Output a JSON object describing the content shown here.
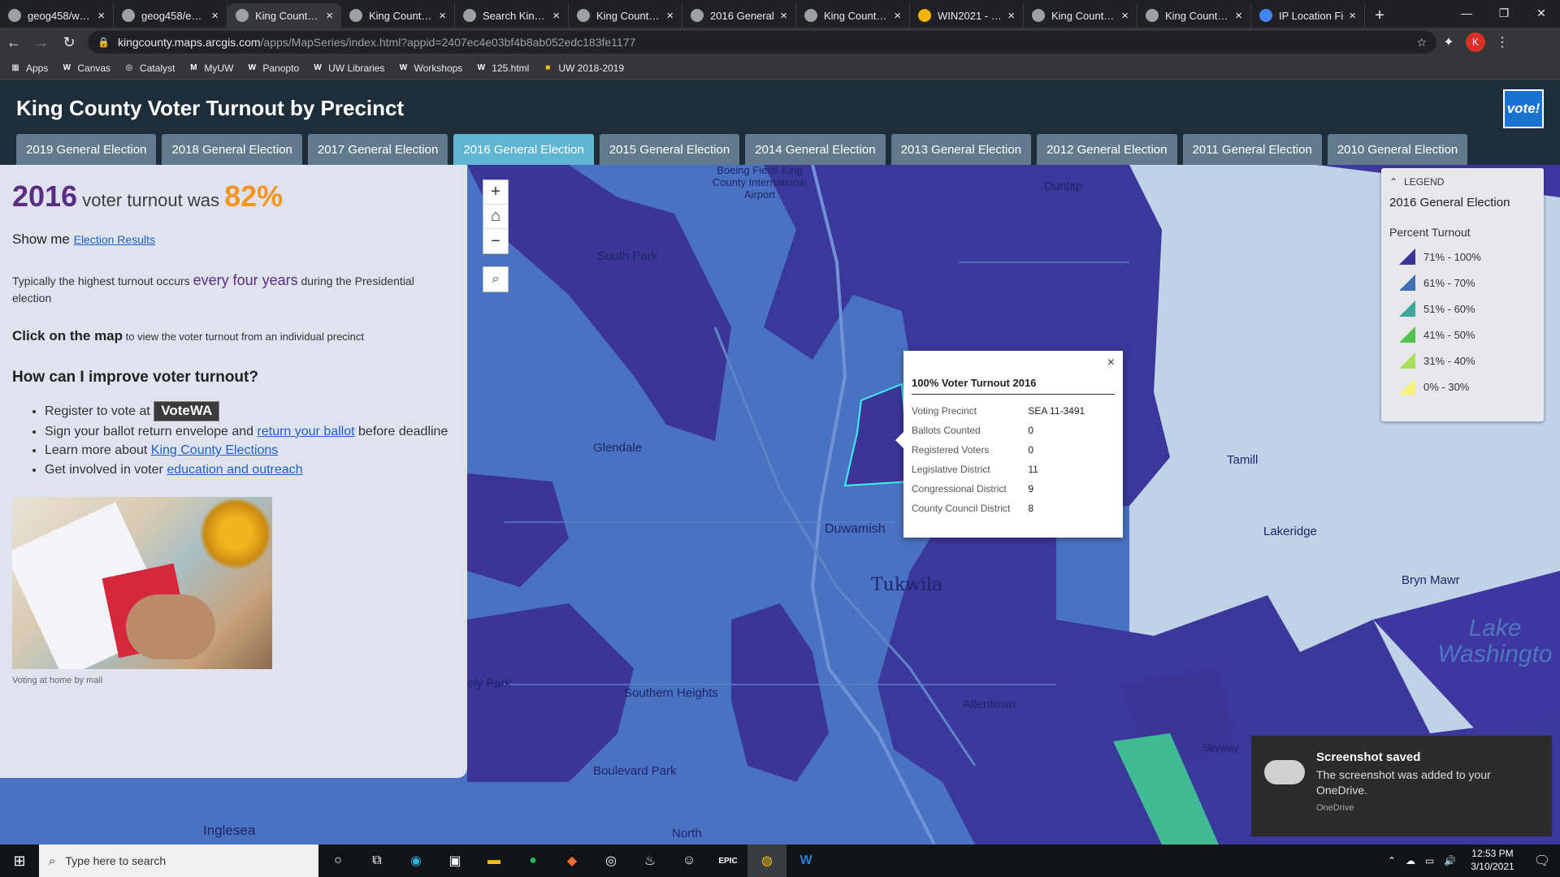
{
  "browser": {
    "tabs": [
      {
        "title": "geog458/week"
      },
      {
        "title": "geog458/essa"
      },
      {
        "title": "King County V"
      },
      {
        "title": "King County V"
      },
      {
        "title": "Search King C"
      },
      {
        "title": "King County G"
      },
      {
        "title": "2016 General"
      },
      {
        "title": "King County G"
      },
      {
        "title": "WIN2021 - Go"
      },
      {
        "title": "King County V"
      },
      {
        "title": "King County V"
      },
      {
        "title": "IP Location Fi"
      }
    ],
    "url_domain": "kingcounty.maps.arcgis.com",
    "url_path": "/apps/MapSeries/index.html?appid=2407ec4e03bf4b8ab052edc183fe1177",
    "profile_initial": "K",
    "bookmarks": [
      "Apps",
      "Canvas",
      "Catalyst",
      "MyUW",
      "Panopto",
      "UW Libraries",
      "Workshops",
      "125.html",
      "UW 2018-2019"
    ]
  },
  "app": {
    "title": "King County Voter Turnout by Precinct",
    "logo_text": "vote!",
    "election_tabs": [
      "2019 General Election",
      "2018 General Election",
      "2017 General Election",
      "2016 General Election",
      "2015 General Election",
      "2014 General Election",
      "2013 General Election",
      "2012 General Election",
      "2011 General Election",
      "2010 General Election"
    ],
    "active_tab_index": 3
  },
  "panel": {
    "year": "2016",
    "turnout_text": "voter turnout was",
    "turnout_pct": "82%",
    "show_me": "Show me",
    "election_results_link": "Election Results",
    "typically_pre": "Typically the highest turnout occurs",
    "typically_em": "every four years",
    "typically_post": "during the Presidential election",
    "click_bold": "Click on the map",
    "click_rest": "to view the voter turnout from an individual precinct",
    "how_heading": "How can I improve voter turnout?",
    "items": {
      "register": "Register to vote at",
      "votewa": "VoteWA",
      "sign_pre": "Sign your ballot return envelope and",
      "sign_link": "return your ballot",
      "sign_post": "before deadline",
      "learn_pre": "Learn more about",
      "learn_link": "King County Elections",
      "involve_pre": "Get involved in voter",
      "involve_link": "education and outreach"
    },
    "caption": "Voting at home by mail"
  },
  "map": {
    "zoom_in": "+",
    "home": "⌂",
    "zoom_out": "−",
    "search": "⌕",
    "popup": {
      "close": "×",
      "title": "100% Voter Turnout 2016",
      "rows": [
        {
          "label": "Voting Precinct",
          "value": "SEA 11-3491"
        },
        {
          "label": "Ballots Counted",
          "value": "0"
        },
        {
          "label": "Registered Voters",
          "value": "0"
        },
        {
          "label": "Legislative District",
          "value": "11"
        },
        {
          "label": "Congressional District",
          "value": "9"
        },
        {
          "label": "County Council District",
          "value": "8"
        }
      ]
    },
    "labels": {
      "tukwila": "Tukwila",
      "lake": "Lake Washingto",
      "boeing": "Boeing Field/ King County International Airport",
      "glendale": "Glendale",
      "south_park": "South Park",
      "duwamish": "Duwamish",
      "allentown": "Allentown",
      "lakeridge": "Lakeridge",
      "bryn_mawr": "Bryn Mawr",
      "southern_heights": "Southern Heights",
      "boulevard_park": "Boulevard Park",
      "inglesea": "Inglesea",
      "tamill": "Tamill",
      "dunlap": "Dunlap",
      "skyway": "Skyway",
      "north": "North",
      "ely_park": "ely Park"
    }
  },
  "legend": {
    "heading": "LEGEND",
    "title": "2016 General Election",
    "subtitle": "Percent Turnout",
    "items": [
      {
        "label": "71% - 100%",
        "color": "#3a3596"
      },
      {
        "label": "61% - 70%",
        "color": "#3d6fb3"
      },
      {
        "label": "51% - 60%",
        "color": "#3fa69a"
      },
      {
        "label": "41% - 50%",
        "color": "#4ec54a"
      },
      {
        "label": "31% - 40%",
        "color": "#a8e05a"
      },
      {
        "label": "0% - 30%",
        "color": "#f6f27c"
      }
    ]
  },
  "toast": {
    "title": "Screenshot saved",
    "body": "The screenshot was added to your OneDrive.",
    "source": "OneDrive"
  },
  "taskbar": {
    "search_placeholder": "Type here to search",
    "time": "12:53 PM",
    "date": "3/10/2021"
  }
}
